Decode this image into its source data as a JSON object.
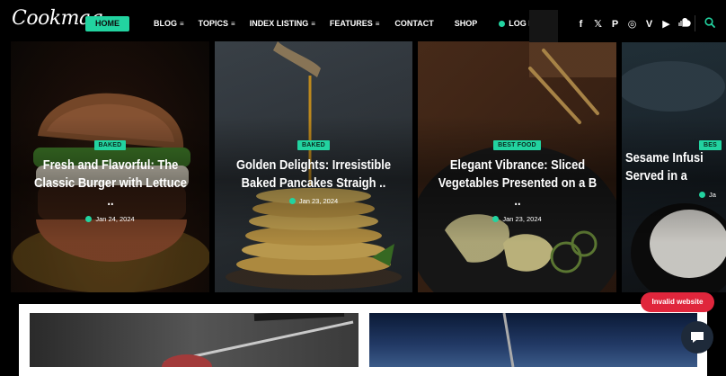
{
  "site": {
    "logo": "Cookmag"
  },
  "nav": {
    "items": [
      {
        "label": "HOME",
        "active": true
      },
      {
        "label": "BLOG",
        "has_menu": true
      },
      {
        "label": "TOPICS",
        "has_menu": true
      },
      {
        "label": "INDEX LISTING",
        "has_menu": true
      },
      {
        "label": "FEATURES",
        "has_menu": true
      },
      {
        "label": "CONTACT"
      },
      {
        "label": "SHOP"
      }
    ],
    "login_label": "LOG IN / SIGN UP",
    "menu_icon": "≡"
  },
  "social": {
    "icons": [
      "facebook-icon",
      "x-icon",
      "pinterest-icon",
      "instagram-icon",
      "vimeo-icon",
      "youtube-icon",
      "soundcloud-icon"
    ],
    "glyphs": {
      "facebook": "f",
      "x": "𝕏",
      "pinterest": "P",
      "instagram": "◎",
      "vimeo": "V",
      "youtube": "▶"
    }
  },
  "cards": [
    {
      "category": "BAKED",
      "title": "Fresh and Flavorful: The Classic Burger with Lettuce ..",
      "date": "Jan 24, 2024"
    },
    {
      "category": "BAKED",
      "title": "Golden Delights: Irresistible Baked Pancakes Straigh ..",
      "date": "Jan 23, 2024"
    },
    {
      "category": "BEST FOOD",
      "title": "Elegant Vibrance: Sliced Vegetables Presented on a B ..",
      "date": "Jan 23, 2024"
    },
    {
      "category": "BES",
      "title": "Sesame Infusi Served in a",
      "date": "Ja"
    }
  ],
  "badge": {
    "invalid_website": "Invalid website"
  },
  "colors": {
    "accent": "#22d3a0",
    "badge_red": "#e0263c",
    "background": "#000000"
  }
}
